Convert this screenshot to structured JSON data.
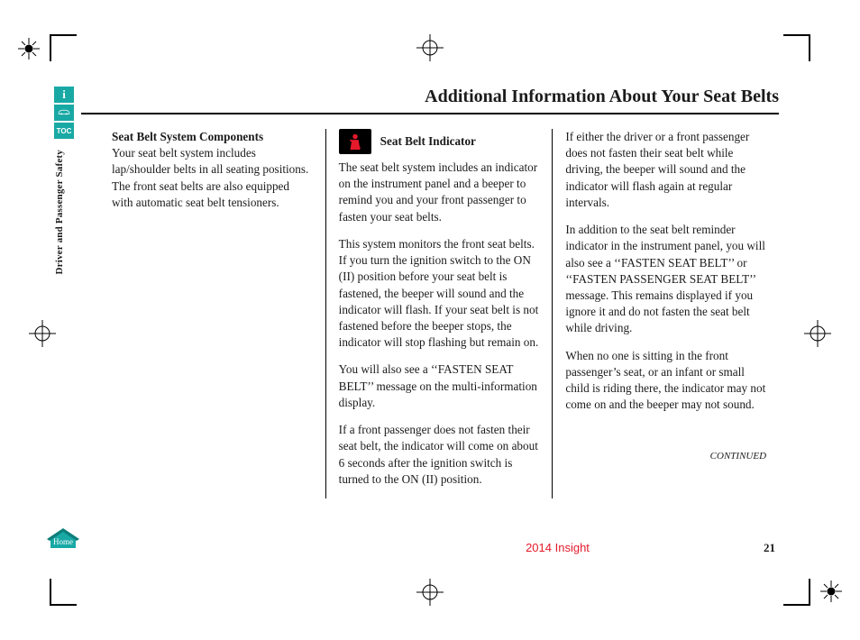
{
  "title": "Additional Information About Your Seat Belts",
  "section_tab": "Driver and Passenger Safety",
  "iconstrip": {
    "info": "i",
    "toc": "TOC"
  },
  "col1": {
    "heading": "Seat Belt System Components",
    "p1": "Your seat belt system includes lap/shoulder belts in all seating positions. The front seat belts are also equipped with automatic seat belt tensioners."
  },
  "col2": {
    "indicator_heading": "Seat Belt Indicator",
    "p1": "The seat belt system includes an indicator on the instrument panel and a beeper to remind you and your front passenger to fasten your seat belts.",
    "p2": "This system monitors the front seat belts. If you turn the ignition switch to the ON (II) position before your seat belt is fastened, the beeper will sound and the indicator will flash. If your seat belt is not fastened before the beeper stops, the indicator will stop flashing but remain on.",
    "p3": "You will also see a ‘‘FASTEN SEAT BELT’’ message on the multi-information display.",
    "p4": "If a front passenger does not fasten their seat belt, the indicator will come on about 6 seconds after the ignition switch is turned to the ON (II) position."
  },
  "col3": {
    "p1": "If either the driver or a front passenger does not fasten their seat belt while driving, the beeper will sound and the indicator will flash again at regular intervals.",
    "p2": "In addition to the seat belt reminder indicator in the instrument panel, you will also see a ‘‘FASTEN SEAT BELT’’ or ‘‘FASTEN PASSENGER SEAT BELT’’ message. This remains displayed if you ignore it and do not fasten the seat belt while driving.",
    "p3": "When no one is sitting in the front passenger’s seat, or an infant or small child is riding there, the indicator may not come on and the beeper may not sound.",
    "continued": "CONTINUED"
  },
  "footer": {
    "model": "2014 Insight",
    "page": "21"
  },
  "home_label": "Home"
}
